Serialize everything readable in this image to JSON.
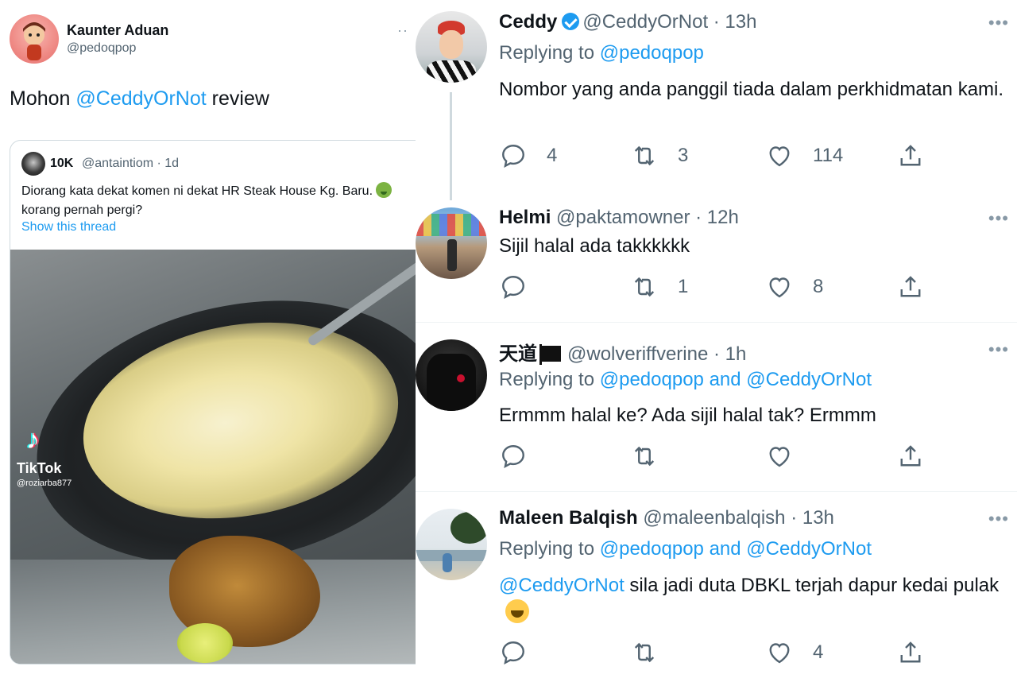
{
  "left": {
    "author": {
      "name": "Kaunter Aduan",
      "handle": "@pedoqpop"
    },
    "more": "··",
    "tweet": {
      "prefix": "Mohon ",
      "mention": "@CeddyOrNot",
      "suffix": " review"
    },
    "quote": {
      "name": "10K",
      "meta": "@antaintiom · 1d",
      "text_before_emoji": "Diorang kata dekat komen ni dekat HR Steak House Kg. Baru.",
      "text_after_emoji": "korang pernah pergi?",
      "emoji": "nauseated-face",
      "show_thread": "Show this thread",
      "media": {
        "watermark": "TikTok",
        "watermark_user": "@roziarba877"
      }
    }
  },
  "replies": [
    {
      "name": "Ceddy",
      "verified": true,
      "meta": "@CeddyOrNot · 13h",
      "replying_prefix": "Replying to ",
      "replying_to": "@pedoqpop",
      "text": "Nombor yang anda panggil tiada dalam perkhidmatan kami.",
      "replies": "4",
      "retweets": "3",
      "likes": "114"
    },
    {
      "name": "Helmi",
      "meta": "@paktamowner · 12h",
      "text": "Sijil halal ada takkkkkk",
      "replies": "",
      "retweets": "1",
      "likes": "8"
    },
    {
      "name": "天道",
      "flag": "black-flag",
      "meta": "@wolveriffverine · 1h",
      "replying_prefix": "Replying to ",
      "replying_to": "@pedoqpop and @CeddyOrNot",
      "text": "Ermmm halal ke? Ada sijil halal tak? Ermmm",
      "replies": "",
      "retweets": "",
      "likes": ""
    },
    {
      "name": "Maleen Balqish",
      "meta": "@maleenbalqish · 13h",
      "replying_prefix": "Replying to ",
      "replying_to": "@pedoqpop and @CeddyOrNot",
      "text_mention": "@CeddyOrNot",
      "text": " sila jadi duta DBKL terjah dapur kedai pulak",
      "emoji": "face-with-tears-of-joy",
      "replies": "",
      "retweets": "",
      "likes": "4"
    }
  ],
  "more_label": "•••",
  "colors": {
    "accent": "#1d9bf0",
    "secondary_text": "#536471",
    "divider": "#eff3f4"
  }
}
